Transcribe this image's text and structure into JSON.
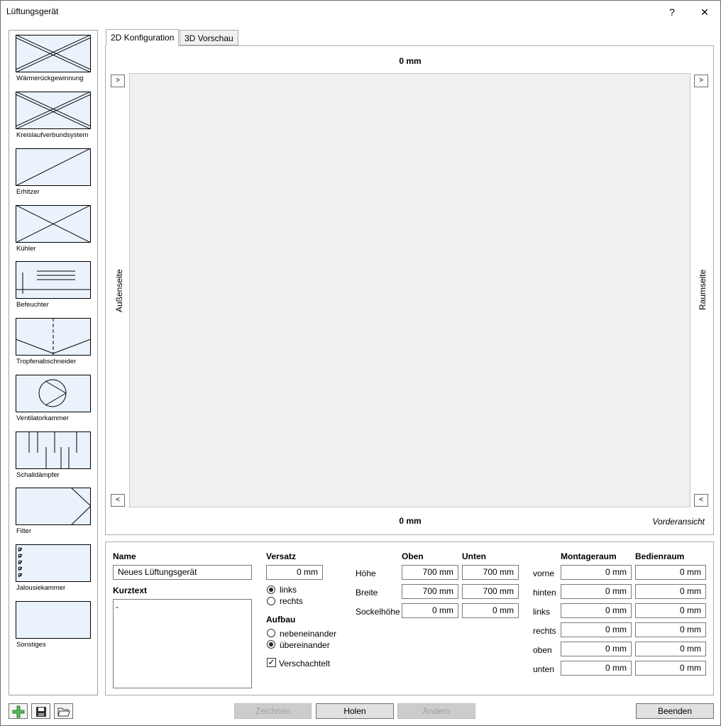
{
  "window": {
    "title": "Lüftungsgerät",
    "help": "?",
    "close": "✕"
  },
  "palette": [
    {
      "label": "Wärmerückgewinnung",
      "icon": "heat-recovery-icon"
    },
    {
      "label": "Kreislaufverbundsystem",
      "icon": "run-around-coil-icon"
    },
    {
      "label": "Erhitzer",
      "icon": "heater-icon"
    },
    {
      "label": "Kühler",
      "icon": "cooler-icon"
    },
    {
      "label": "Befeuchter",
      "icon": "humidifier-icon"
    },
    {
      "label": "Tropfenabschneider",
      "icon": "droplet-separator-icon"
    },
    {
      "label": "Ventilatorkammer",
      "icon": "fan-chamber-icon"
    },
    {
      "label": "Schalldämpfer",
      "icon": "silencer-icon"
    },
    {
      "label": "Filter",
      "icon": "filter-icon"
    },
    {
      "label": "Jalousiekammer",
      "icon": "louver-chamber-icon"
    },
    {
      "label": "Sonstiges",
      "icon": "misc-icon"
    }
  ],
  "tabs": {
    "config": "2D Konfiguration",
    "preview": "3D Vorschau"
  },
  "canvas": {
    "top_dim": "0 mm",
    "bottom_dim": "0 mm",
    "left_side": "Außenseite",
    "right_side": "Raumseite",
    "view": "Vorderansicht",
    "nav_next": ">",
    "nav_prev": "<"
  },
  "props": {
    "name_label": "Name",
    "name_value": "Neues Lüftungsgerät",
    "kurztext_label": "Kurztext",
    "kurztext_value": "-",
    "versatz_label": "Versatz",
    "versatz_value": "0 mm",
    "versatz_links": "links",
    "versatz_rechts": "rechts",
    "aufbau_label": "Aufbau",
    "aufbau_neben": "nebeneinander",
    "aufbau_ueber": "übereinander",
    "verschachtelt": "Verschachtelt",
    "col_oben": "Oben",
    "col_unten": "Unten",
    "rows": [
      {
        "label": "Höhe",
        "oben": "700 mm",
        "unten": "700 mm"
      },
      {
        "label": "Breite",
        "oben": "700 mm",
        "unten": "700 mm"
      },
      {
        "label": "Sockelhöhe",
        "oben": "0 mm",
        "unten": "0 mm"
      }
    ],
    "col_montage": "Montageraum",
    "col_bedien": "Bedienraum",
    "space_rows": [
      {
        "label": "vorne",
        "montage": "0 mm",
        "bedien": "0 mm"
      },
      {
        "label": "hinten",
        "montage": "0 mm",
        "bedien": "0 mm"
      },
      {
        "label": "links",
        "montage": "0 mm",
        "bedien": "0 mm"
      },
      {
        "label": "rechts",
        "montage": "0 mm",
        "bedien": "0 mm"
      },
      {
        "label": "oben",
        "montage": "0 mm",
        "bedien": "0 mm"
      },
      {
        "label": "unten",
        "montage": "0 mm",
        "bedien": "0 mm"
      }
    ]
  },
  "buttons": {
    "zeichnen": "Zeichnen",
    "holen": "Holen",
    "aendern": "Ändern",
    "beenden": "Beenden"
  }
}
